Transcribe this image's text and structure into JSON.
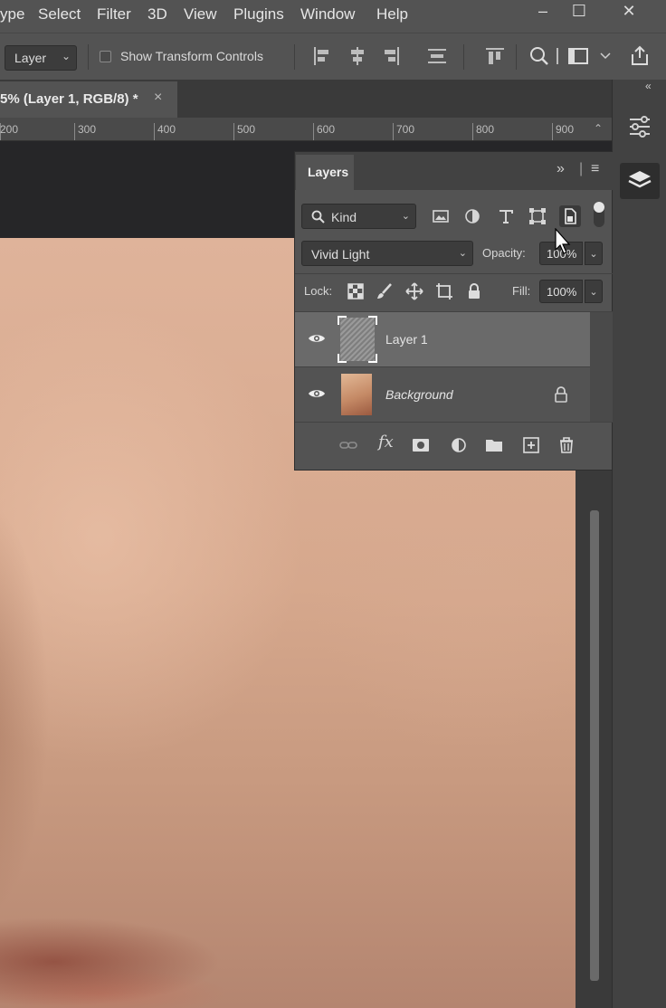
{
  "menu": {
    "items": [
      "ype",
      "Select",
      "Filter",
      "3D",
      "View",
      "Plugins",
      "Window",
      "Help"
    ],
    "window_controls": [
      "–",
      "☐",
      "✕"
    ]
  },
  "options_bar": {
    "tool_select": "Layer",
    "show_transform_controls": "Show Transform Controls"
  },
  "document": {
    "tab_title": "5% (Layer 1, RGB/8) *",
    "close": "×"
  },
  "ruler": {
    "labels": [
      "200",
      "300",
      "400",
      "500",
      "600",
      "700",
      "800",
      "900"
    ]
  },
  "layers_panel": {
    "tab": "Layers",
    "filter_kind": "Kind",
    "blend_mode": "Vivid Light",
    "opacity_label": "Opacity:",
    "opacity_value": "100%",
    "lock_label": "Lock:",
    "fill_label": "Fill:",
    "fill_value": "100%",
    "layers": [
      {
        "name": "Layer 1",
        "visible": true,
        "selected": true,
        "locked": false
      },
      {
        "name": "Background",
        "visible": true,
        "selected": false,
        "locked": true
      }
    ]
  },
  "colors": {
    "ui_panel": "#535353",
    "ui_dark": "#3c3c3c",
    "selected_row": "#6a6a6a",
    "canvas_bg": "#262628",
    "skin": "#d6a88d"
  }
}
